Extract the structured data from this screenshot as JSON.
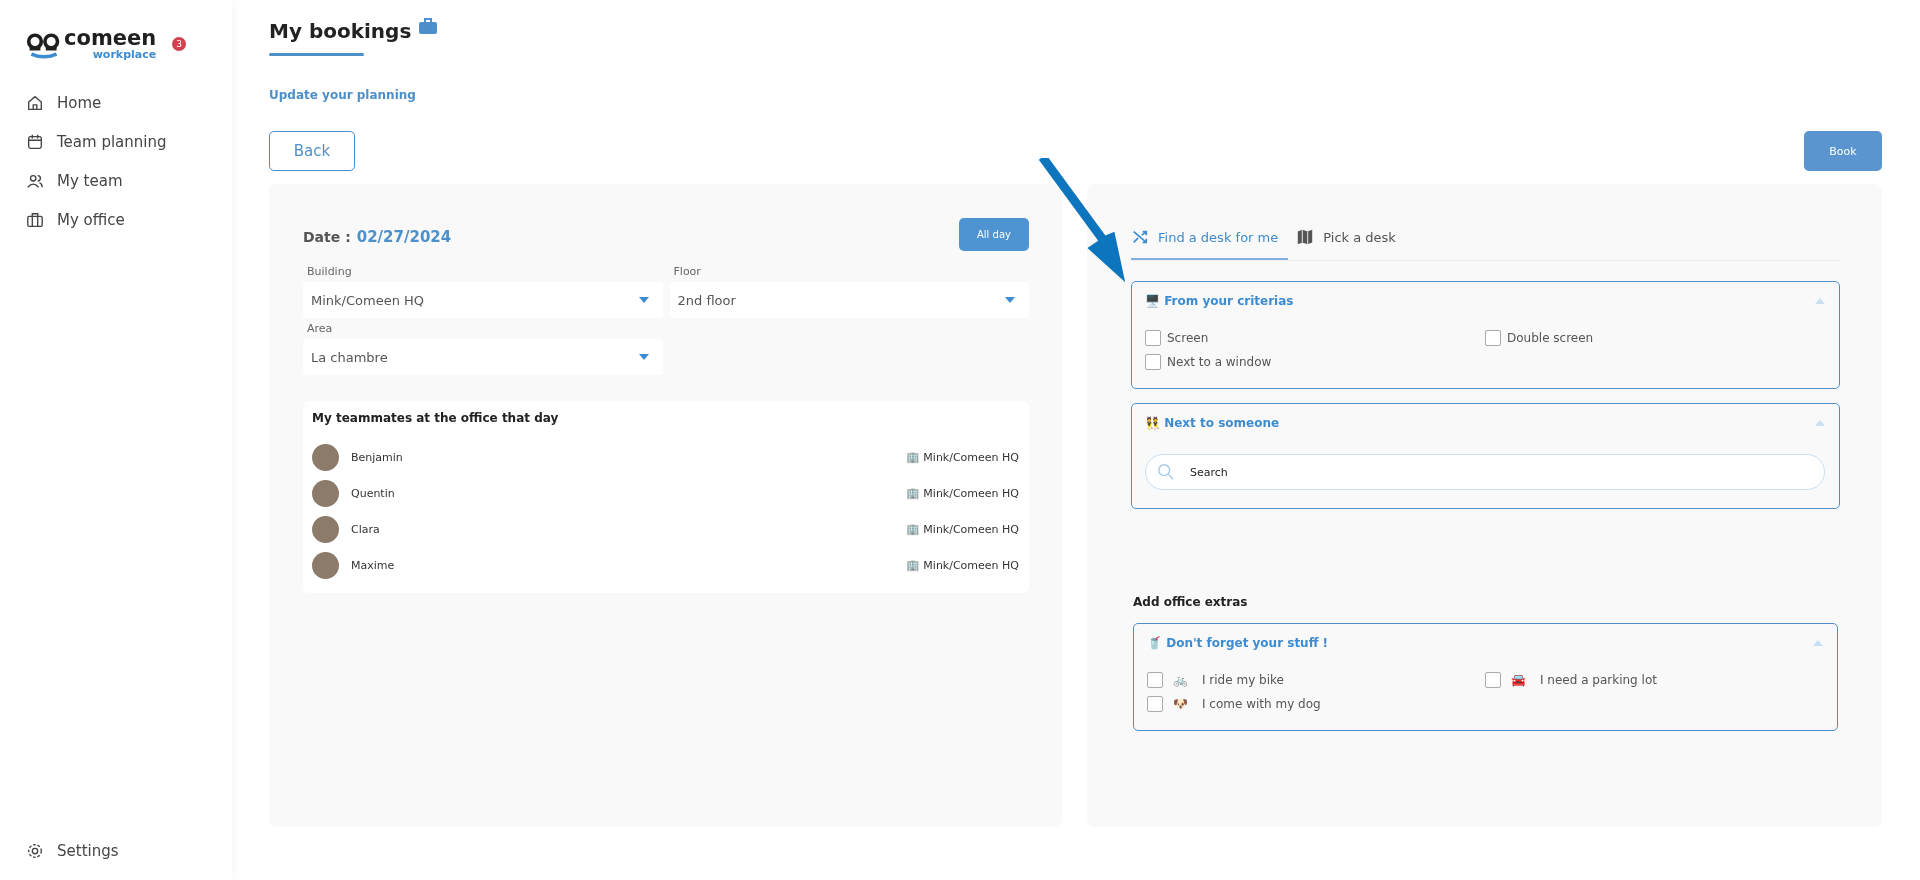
{
  "sidebar": {
    "logo": {
      "word": "comeen",
      "sub": "workplace"
    },
    "badge": "3",
    "items": [
      {
        "label": "Home",
        "selected": false
      },
      {
        "label": "Team planning",
        "selected": false
      },
      {
        "label": "My team",
        "selected": false
      },
      {
        "label": "My office",
        "selected": false
      }
    ],
    "settings": "Settings"
  },
  "header": {
    "title": "My bookings",
    "link": "Update your planning",
    "back": "Back",
    "book": "Book"
  },
  "left": {
    "date_label": "Date :",
    "date": "02/27/2024",
    "all_day": "All day",
    "selects": [
      {
        "label": "Building",
        "value": "Mink/Comeen HQ"
      },
      {
        "label": "Floor",
        "value": "2nd floor"
      },
      {
        "label": "Area",
        "value": "La chambre"
      }
    ],
    "teammates_title": "My teammates at the office that day",
    "teammates": [
      {
        "name": "Benjamin",
        "place": "🏢 Mink/Comeen HQ"
      },
      {
        "name": "Quentin",
        "place": "🏢 Mink/Comeen HQ"
      },
      {
        "name": "Clara",
        "place": "🏢 Mink/Comeen HQ"
      },
      {
        "name": "Maxime",
        "place": "🏢 Mink/Comeen HQ"
      }
    ]
  },
  "right": {
    "tabs": [
      {
        "label": "Find a desk for me",
        "selected": true
      },
      {
        "label": "Pick a desk",
        "selected": false
      }
    ],
    "sections": [
      {
        "kind": "checkboxes",
        "title": "🖥️ From your criterias",
        "expanded": true,
        "options": [
          {
            "label": "Screen",
            "checked": false
          },
          {
            "label": "Double screen",
            "checked": false
          },
          {
            "label": "Next to a window",
            "checked": false
          }
        ]
      },
      {
        "kind": "search",
        "title": "👯 Next to someone",
        "expanded": true,
        "placeholder": "Search"
      }
    ],
    "extras_title": "Add office extras",
    "extras": {
      "title": "🥤 Don't forget your stuff !",
      "expanded": true,
      "options": [
        {
          "emoji": "🚲",
          "label": "I ride my bike",
          "checked": false
        },
        {
          "emoji": "🚘",
          "label": "I need a parking lot",
          "checked": false
        },
        {
          "emoji": "🐶",
          "label": "I come with my dog",
          "checked": false
        }
      ]
    }
  }
}
